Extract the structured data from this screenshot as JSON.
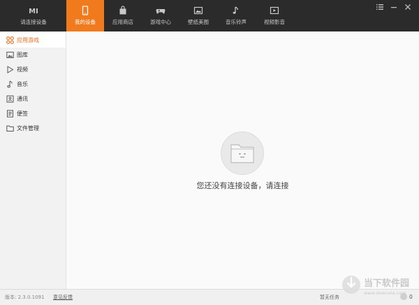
{
  "topbar": {
    "tabs": [
      {
        "label": "请连接设备",
        "icon": "mi-logo-icon",
        "active": false
      },
      {
        "label": "我的设备",
        "icon": "phone-icon",
        "active": true
      },
      {
        "label": "应用商店",
        "icon": "shopping-bag-icon",
        "active": false
      },
      {
        "label": "游戏中心",
        "icon": "gamepad-icon",
        "active": false
      },
      {
        "label": "壁纸美图",
        "icon": "picture-icon",
        "active": false
      },
      {
        "label": "音乐铃声",
        "icon": "music-note-icon",
        "active": false
      },
      {
        "label": "视频影音",
        "icon": "video-play-icon",
        "active": false
      }
    ],
    "mi_logo": "MI",
    "accent_color": "#f07a1c"
  },
  "window_controls": [
    "menu-icon",
    "minimize-icon",
    "close-icon"
  ],
  "sidebar": {
    "items": [
      {
        "label": "应用游戏",
        "icon": "apps-grid-icon",
        "active": true
      },
      {
        "label": "图库",
        "icon": "gallery-icon",
        "active": false
      },
      {
        "label": "视频",
        "icon": "play-icon",
        "active": false
      },
      {
        "label": "音乐",
        "icon": "music-icon",
        "active": false
      },
      {
        "label": "通讯",
        "icon": "contacts-icon",
        "active": false
      },
      {
        "label": "便签",
        "icon": "note-icon",
        "active": false
      },
      {
        "label": "文件管理",
        "icon": "folder-icon",
        "active": false
      }
    ]
  },
  "main": {
    "empty_message": "您还没有连接设备，请连接"
  },
  "statusbar": {
    "version": "版本: 2.3.0.1091",
    "feedback": "意见反馈",
    "task_status": "暂无任务",
    "task_count": "0"
  },
  "watermark": {
    "title": "当下软件园",
    "url": "www.downxia.com"
  }
}
